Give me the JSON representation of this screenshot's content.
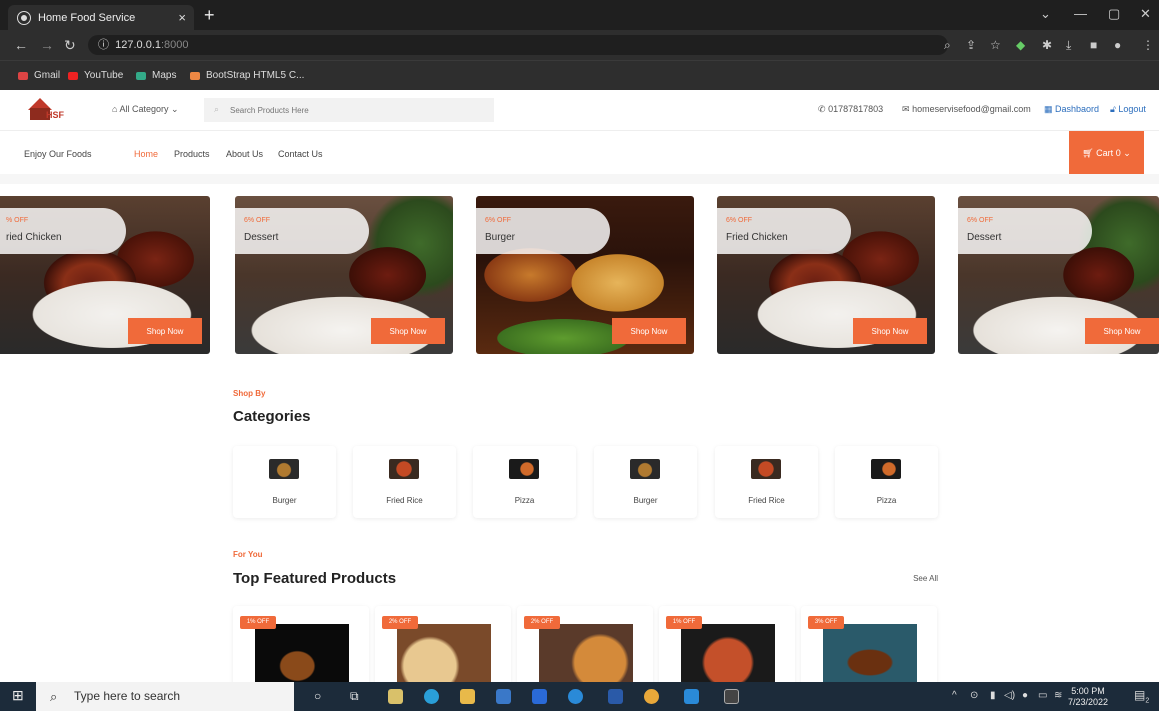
{
  "browser": {
    "tab_title": "Home Food Service",
    "tab_close": "×",
    "new_tab": "+",
    "url_host": "127.0.0.1",
    "url_port": ":8000",
    "bookmarks": [
      "Gmail",
      "YouTube",
      "Maps",
      "BootStrap HTML5 C..."
    ],
    "window_controls": [
      "⌄",
      "—",
      "▢",
      "✕"
    ]
  },
  "header": {
    "logo_text": "HSF",
    "all_category": "All Category",
    "search_placeholder": "Search Products Here",
    "phone": "01787817803",
    "email": "homeservisefood@gmail.com",
    "dashboard": "Dashbaord",
    "logout": "Logout"
  },
  "subnav": {
    "tagline": "Enjoy Our Foods",
    "links": [
      "Home",
      "Products",
      "About Us",
      "Contact Us"
    ],
    "cart_label": "Cart",
    "cart_count": "0"
  },
  "banners": [
    {
      "off": "% OFF",
      "name": "ried Chicken",
      "button": "Shop Now"
    },
    {
      "off": "6% OFF",
      "name": "Dessert",
      "button": "Shop Now"
    },
    {
      "off": "6% OFF",
      "name": "Burger",
      "button": "Shop Now"
    },
    {
      "off": "6% OFF",
      "name": "Fried Chicken",
      "button": "Shop Now"
    },
    {
      "off": "6% OFF",
      "name": "Dessert",
      "button": "Shop Now"
    }
  ],
  "categories": {
    "subtitle": "Shop By",
    "title": "Categories",
    "items": [
      "Burger",
      "Fried Rice",
      "Pizza",
      "Burger",
      "Fried Rice",
      "Pizza"
    ]
  },
  "featured": {
    "subtitle": "For You",
    "title": "Top Featured Products",
    "see_all": "See All",
    "badges": [
      "1% OFF",
      "2% OFF",
      "2% OFF",
      "1% OFF",
      "3% OFF"
    ]
  },
  "taskbar": {
    "search_placeholder": "Type here to search",
    "time": "5:00 PM",
    "date": "7/23/2022",
    "notif_count": "2"
  }
}
